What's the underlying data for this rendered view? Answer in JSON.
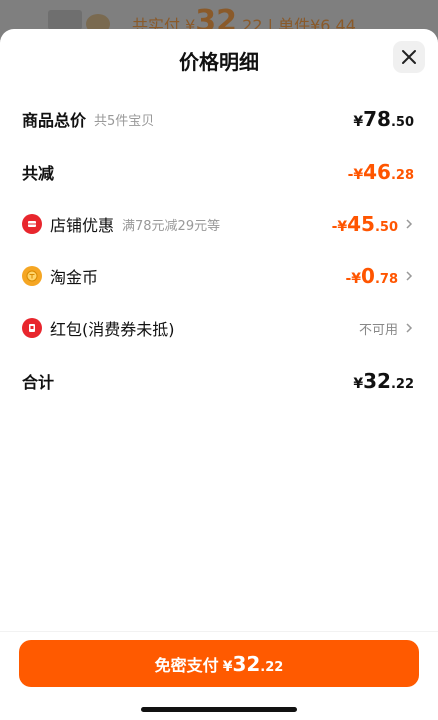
{
  "background": {
    "text_prefix": "共实付",
    "price_symbol": "¥",
    "price_int": "32",
    "price_dec": ".22",
    "separator": "|",
    "unit_text": "单件¥6.44"
  },
  "sheet": {
    "title": "价格明细",
    "close_icon": "close-icon"
  },
  "rows": {
    "total_goods": {
      "label": "商品总价",
      "sub": "共5件宝贝",
      "symbol": "¥",
      "int": "78",
      "dec": ".50"
    },
    "total_reduce": {
      "label": "共减",
      "symbol": "-¥",
      "int": "46",
      "dec": ".28"
    },
    "shop_discount": {
      "label": "店铺优惠",
      "sub": "满78元减29元等",
      "symbol": "-¥",
      "int": "45",
      "dec": ".50",
      "icon": "store-coupon-icon",
      "icon_color": "#e8262d"
    },
    "tao_coins": {
      "label": "淘金币",
      "symbol": "-¥",
      "int": "0",
      "dec": ".78",
      "icon": "gold-coin-icon",
      "icon_color": "#f5a623"
    },
    "red_packet": {
      "label": "红包(消费券未抵)",
      "status": "不可用",
      "icon": "red-packet-icon",
      "icon_color": "#e8262d"
    },
    "sum": {
      "label": "合计",
      "symbol": "¥",
      "int": "32",
      "dec": ".22"
    }
  },
  "pay_button": {
    "label": "免密支付",
    "symbol": "¥",
    "int": "32",
    "dec": ".22",
    "color": "#ff5a00"
  },
  "colors": {
    "accent": "#ff5500",
    "text": "#111111",
    "muted": "#999999"
  }
}
